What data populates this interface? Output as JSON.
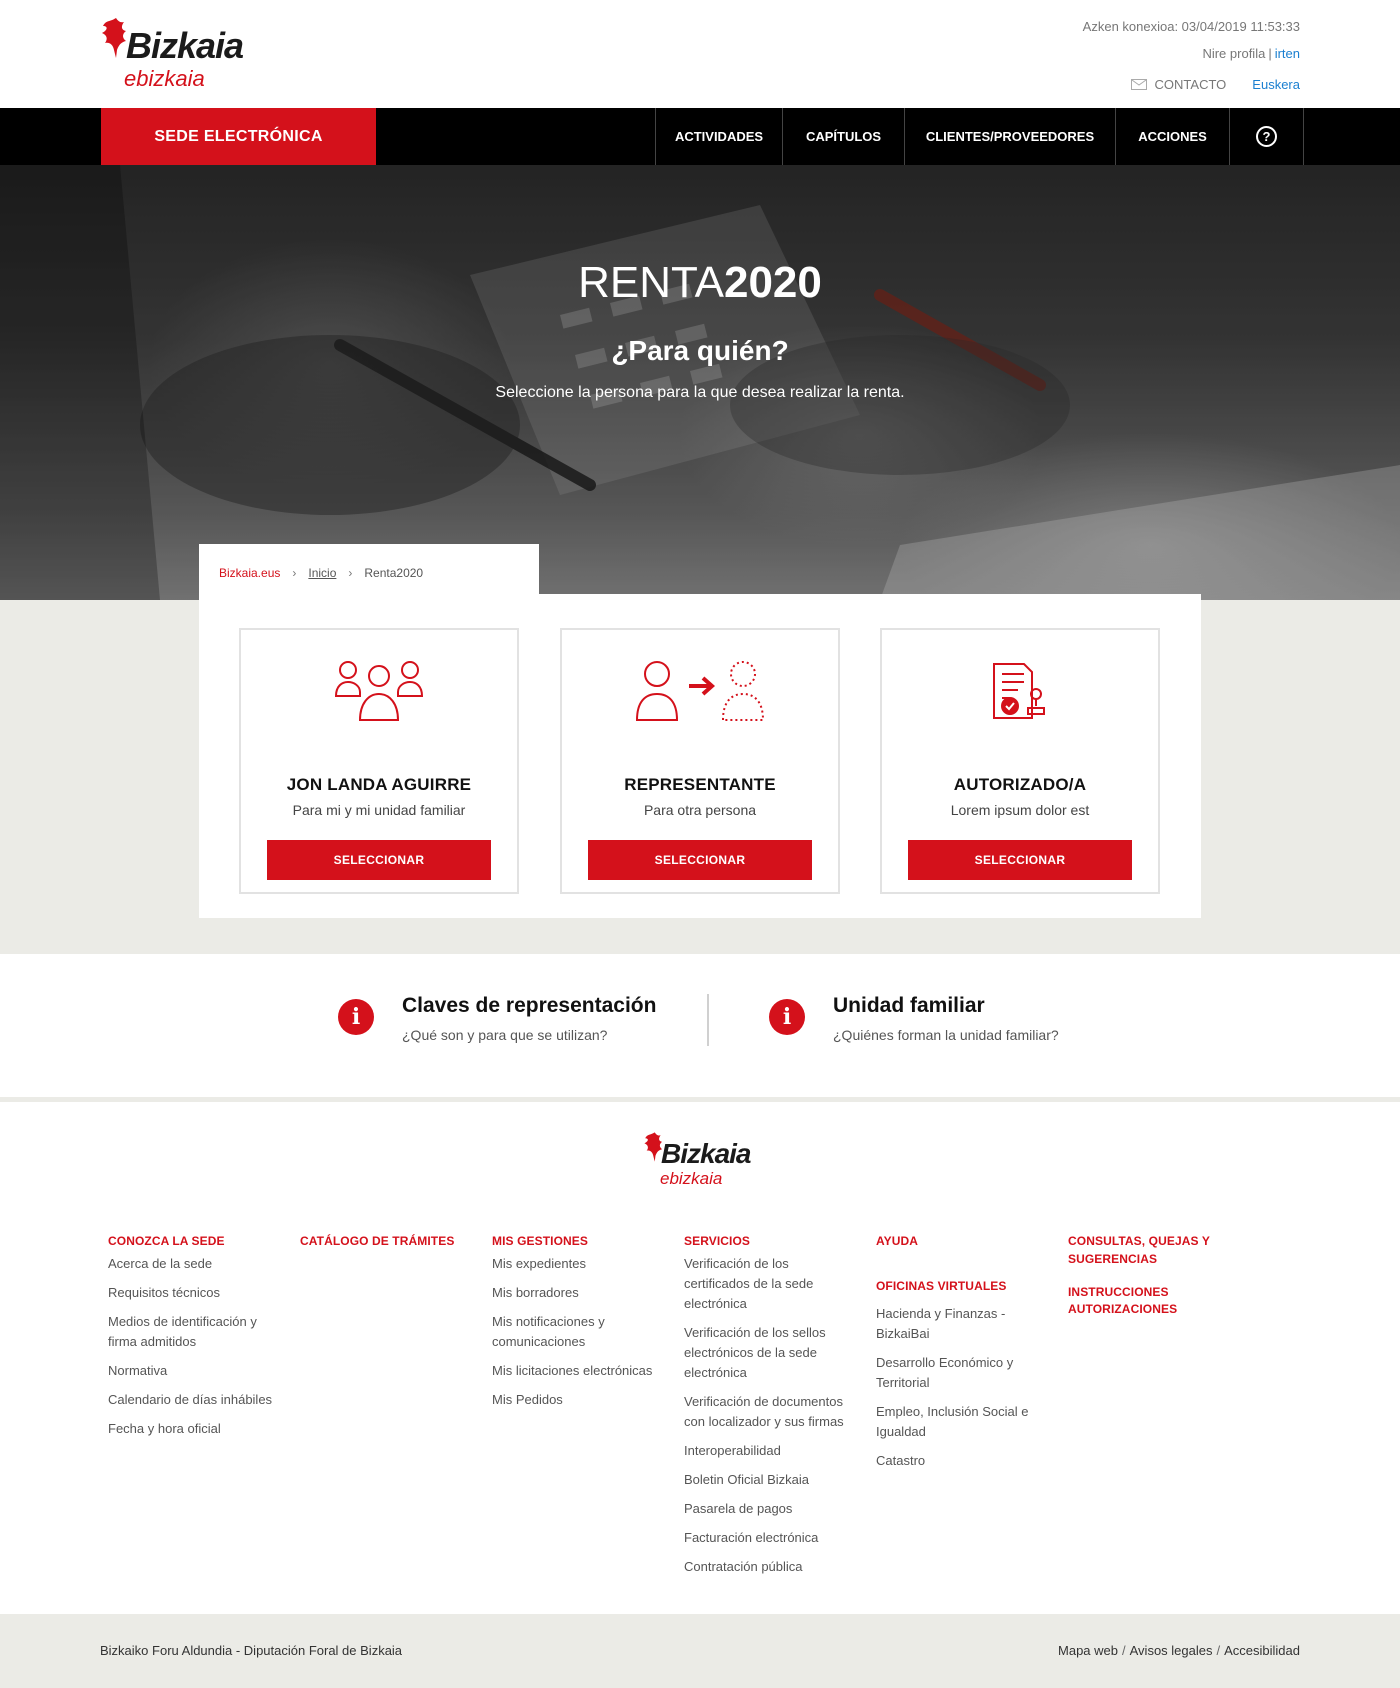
{
  "header": {
    "brand": "Bizkaia",
    "brand_sub": "ebizkaia",
    "last_connection": "Azken konexioa: 03/04/2019 11:53:33",
    "profile_link": "Nire profila",
    "profile_sep": "|",
    "logout_link": "irten",
    "contact_label": "CONTACTO",
    "language_link": "Euskera"
  },
  "nav": {
    "sede_label": "SEDE ELECTRÓNICA",
    "items": [
      {
        "label": "ACTIVIDADES"
      },
      {
        "label": "CAPÍTULOS"
      },
      {
        "label": "CLIENTES/PROVEEDORES"
      },
      {
        "label": "ACCIONES"
      }
    ],
    "help_symbol": "?"
  },
  "hero": {
    "title_light": "RENTA",
    "title_bold": "2020",
    "subtitle": "¿Para quién?",
    "description": "Seleccione la persona para la que desea realizar la renta."
  },
  "breadcrumb": {
    "home": "Bizkaia.eus",
    "sep": "›",
    "inicio": "Inicio",
    "current": "Renta2020"
  },
  "cards": [
    {
      "icon": "family-group-icon",
      "name": "JON LANDA AGUIRRE",
      "description": "Para mi y mi unidad familiar",
      "button": "SELECCIONAR"
    },
    {
      "icon": "representative-icon",
      "name": "REPRESENTANTE",
      "description": "Para otra persona",
      "button": "SELECCIONAR"
    },
    {
      "icon": "authorized-document-icon",
      "name": "AUTORIZADO/A",
      "description": "Lorem ipsum dolor est",
      "button": "SELECCIONAR"
    }
  ],
  "info": [
    {
      "icon": "info-icon",
      "badge": "i",
      "title": "Claves de representación",
      "subtitle": "¿Qué son y para que se utilizan?"
    },
    {
      "icon": "info-icon",
      "badge": "i",
      "title": "Unidad familiar",
      "subtitle": "¿Quiénes forman la unidad familiar?"
    }
  ],
  "footer": {
    "brand": "Bizkaia",
    "brand_sub": "ebizkaia",
    "col1": {
      "head": "CONOZCA LA SEDE",
      "links": [
        "Acerca de la sede",
        "Requisitos técnicos",
        "Medios de identificación y firma admitidos",
        "Normativa",
        "Calendario de días inhábiles",
        "Fecha y hora oficial"
      ]
    },
    "col2": {
      "head": "CATÁLOGO DE TRÁMITES"
    },
    "col3": {
      "head": "MIS GESTIONES",
      "links": [
        "Mis expedientes",
        "Mis borradores",
        "Mis notificaciones y comunicaciones",
        "Mis licitaciones electrónicas",
        "Mis Pedidos"
      ]
    },
    "col4": {
      "head": "SERVICIOS",
      "links": [
        "Verificación de los certificados de la sede electrónica",
        "Verificación de los sellos electrónicos de la sede electrónica",
        "Verificación de documentos con localizador y sus firmas",
        "Interoperabilidad",
        "Boletin Oficial Bizkaia",
        "Pasarela de pagos",
        "Facturación electrónica",
        "Contratación pública"
      ]
    },
    "col5": {
      "head": "AYUDA",
      "head2": "OFICINAS VIRTUALES",
      "links": [
        "Hacienda y Finanzas - BizkaiBai",
        "Desarrollo Económico y Territorial",
        "Empleo, Inclusión Social e Igualdad",
        "Catastro"
      ]
    },
    "col6": {
      "head": "CONSULTAS, QUEJAS Y SUGERENCIAS",
      "head2": "INSTRUCCIONES AUTORIZACIONES"
    },
    "copyright": "Bizkaiko Foru Aldundia - Diputación Foral de Bizkaia",
    "bottom_links": [
      "Mapa web",
      "Avisos legales",
      "Accesibilidad"
    ],
    "bottom_sep": "/"
  },
  "colors": {
    "accent": "#d4111b",
    "nav": "#000000",
    "grey_bg": "#ebebe6",
    "link_blue": "#1a7fd0"
  }
}
